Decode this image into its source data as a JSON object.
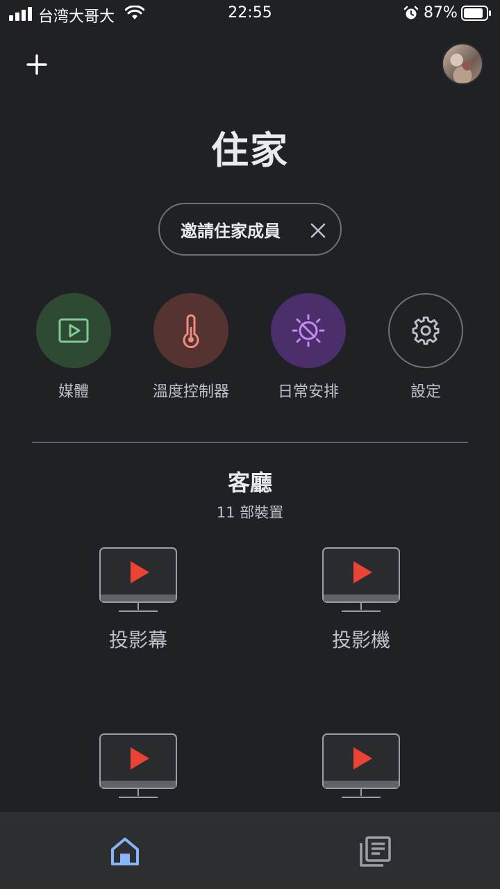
{
  "status_bar": {
    "carrier": "台湾大哥大",
    "time": "22:55",
    "battery_percent": "87%",
    "battery_level": 0.87,
    "icons": [
      "signal-icon",
      "wifi-icon",
      "alarm-icon",
      "battery-icon"
    ]
  },
  "header": {
    "add_icon": "plus-icon",
    "title": "住家"
  },
  "invite_chip": {
    "label": "邀請住家成員",
    "close_icon": "close-icon"
  },
  "shortcuts": [
    {
      "label": "媒體",
      "icon": "play-screen-icon",
      "color": "#81c995"
    },
    {
      "label": "溫度控制器",
      "icon": "thermometer-icon",
      "color": "#f28b82"
    },
    {
      "label": "日常安排",
      "icon": "routine-sun-moon-icon",
      "color": "#c58af9"
    },
    {
      "label": "設定",
      "icon": "gear-icon",
      "color": "#bdc1c6"
    }
  ],
  "room": {
    "name": "客廳",
    "device_count": "11 部裝置",
    "devices": [
      {
        "label": "投影幕",
        "icon": "tv-play-icon"
      },
      {
        "label": "投影機",
        "icon": "tv-play-icon"
      },
      {
        "label": "",
        "icon": "tv-play-icon"
      },
      {
        "label": "",
        "icon": "tv-play-icon"
      }
    ]
  },
  "bottom_nav": {
    "items": [
      {
        "icon": "home-icon",
        "active": true
      },
      {
        "icon": "feed-icon",
        "active": false
      }
    ]
  },
  "colors": {
    "background": "#202124",
    "nav_background": "#2d2e31",
    "accent_blue": "#8ab4f8",
    "play_red": "#ea4335"
  }
}
